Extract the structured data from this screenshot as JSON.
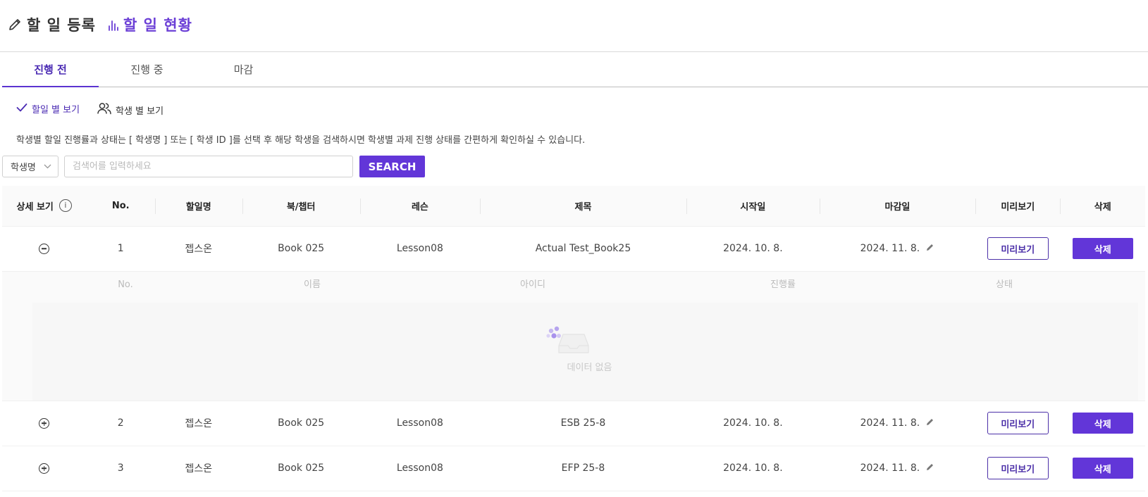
{
  "header": {
    "register_tab": "할 일 등록",
    "status_tab": "할 일 현황"
  },
  "subtabs": [
    "진행 전",
    "진행 중",
    "마감"
  ],
  "view_options": {
    "by_task": "할일 별 보기",
    "by_student": "학생 별 보기"
  },
  "guide_text": "학생별 할일 진행률과 상태는 [ 학생명 ] 또는 [ 학생 ID ]를 선택 후 해당 학생을 검색하시면 학생별 과제 진행 상태를 간편하게 확인하실 수 있습니다.",
  "search": {
    "select_value": "학생명",
    "placeholder": "검색어를 입력하세요",
    "button": "SEARCH"
  },
  "table": {
    "headers": {
      "detail": "상세 보기",
      "no": "No.",
      "task": "할일명",
      "book": "북/챕터",
      "lesson": "레슨",
      "title": "제목",
      "start": "시작일",
      "due": "마감일",
      "preview": "미리보기",
      "delete": "삭제"
    },
    "rows": [
      {
        "no": "1",
        "task": "젭스온",
        "book": "Book 025",
        "lesson": "Lesson08",
        "title": "Actual Test_Book25",
        "start": "2024. 10. 8.",
        "due": "2024. 11. 8.",
        "preview": "미리보기",
        "delete": "삭제"
      },
      {
        "no": "2",
        "task": "젭스온",
        "book": "Book 025",
        "lesson": "Lesson08",
        "title": "ESB 25-8",
        "start": "2024. 10. 8.",
        "due": "2024. 11. 8.",
        "preview": "미리보기",
        "delete": "삭제"
      },
      {
        "no": "3",
        "task": "젭스온",
        "book": "Book 025",
        "lesson": "Lesson08",
        "title": "EFP 25-8",
        "start": "2024. 10. 8.",
        "due": "2024. 11. 8.",
        "preview": "미리보기",
        "delete": "삭제"
      }
    ],
    "expanded": {
      "headers": {
        "no": "No.",
        "name": "이름",
        "id": "아이디",
        "progress": "진행률",
        "status": "상태"
      },
      "empty_text": "데이터 없음"
    }
  },
  "colors": {
    "accent": "#6236d8",
    "accent_text": "#4a2ab3"
  }
}
